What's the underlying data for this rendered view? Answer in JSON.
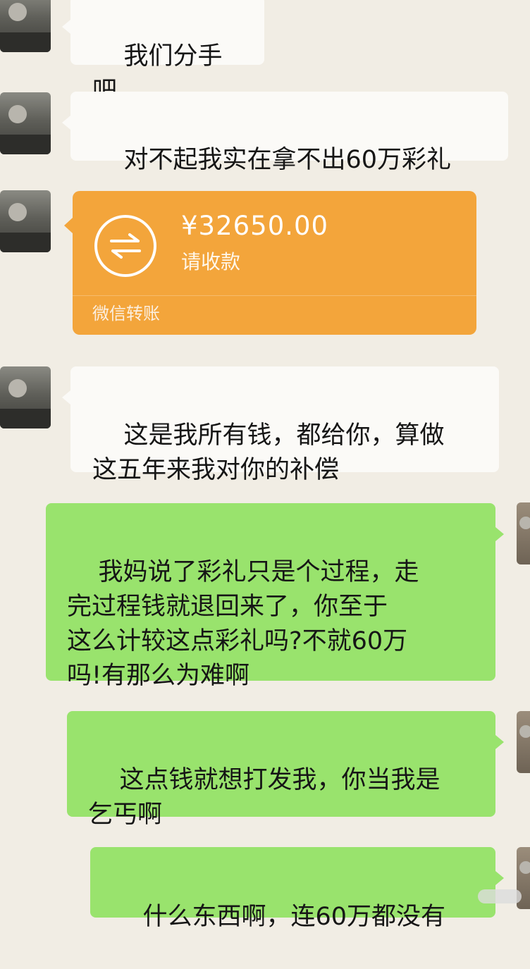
{
  "messages": [
    {
      "text": "我们分手吧"
    },
    {
      "text": "对不起我实在拿不出60万彩礼"
    },
    {
      "type": "transfer",
      "amount": "¥32650.00",
      "status": "请收款",
      "label": "微信转账"
    },
    {
      "text": "这是我所有钱，都给你，算做\n这五年来我对你的补偿"
    },
    {
      "text": "我妈说了彩礼只是个过程，走\n完过程钱就退回来了，你至于\n这么计较这点彩礼吗?不就60万\n吗!有那么为难啊"
    },
    {
      "text": "这点钱就想打发我，你当我是\n乞丐啊"
    },
    {
      "text": "什么东西啊，连60万都没有"
    }
  ],
  "colors": {
    "left_bubble": "#fbfaf7",
    "right_bubble": "#99e36d",
    "transfer": "#f3a53b",
    "background": "#f1ede4"
  },
  "icons": {
    "transfer": "transfer-arrows-icon"
  }
}
